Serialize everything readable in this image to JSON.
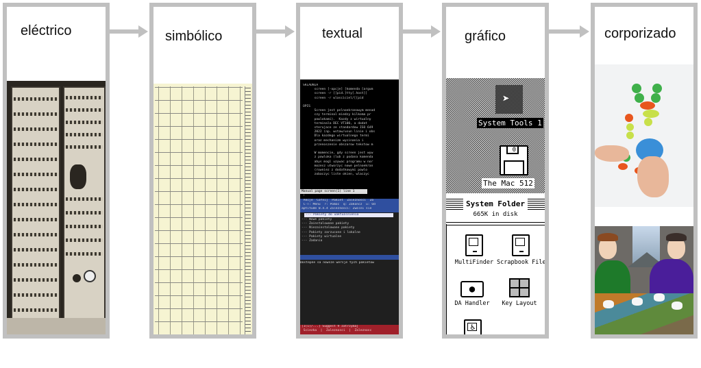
{
  "diagram": {
    "stages": [
      {
        "id": "electric",
        "title": "eléctrico",
        "image": "early electromechanical computer rack"
      },
      {
        "id": "symbolic",
        "title": "simbólico",
        "image": "punched symbolic code sheet"
      },
      {
        "id": "textual",
        "title": "textual",
        "image": "text-mode terminal screen"
      },
      {
        "id": "graphical",
        "title": "gráfico",
        "image": "classic Macintosh desktop"
      },
      {
        "id": "embodied",
        "title": "corporizado",
        "image": "tangible robot kit and virtual characters"
      }
    ],
    "connectors": [
      "arrow",
      "arrow",
      "arrow",
      "arrow"
    ],
    "colors": {
      "frame": "#c0c0c0",
      "arrow": "#c0c0c0",
      "background": "#ffffff",
      "text": "#111111"
    }
  },
  "terminal": {
    "lines": [
      "SKLADNIA",
      "      screen [-opcje] [komenda [argum",
      "      screen -r [[pid.]tty[.host]]",
      "      screen -r wlasciciel/[[pid",
      "",
      "OPIS",
      "      Screen jest pelnoekranowym menad",
      "      czy terminal miedzy kilkoma pr",
      "      powlokami).  Kazdy z wirtualny",
      "      terminala DEC VT100, a dodat",
      "      sterujace ze standardow ISO 649",
      "      2022 (np. wstaw/usun linie i obs",
      "      Dla kazdego wirtualnego termi",
      "      oraz mechanizm wycinania i",
      "      przenoszenie obszarow tekstow m",
      "",
      "      W momencie, gdy screen jest wyw",
      "      z powloka (lub z podana komenda",
      "      abys mogl uzywac programu w nor",
      "      mozesz utworzyc nowe pelnoekran",
      "      (rowniez z dodatkowymi powlo",
      "      zobaczyc liste okien, wlaczyc"
    ],
    "status_line": "Manual page screen(1) line 1",
    "prompt": ":",
    "menu_lines": [
      " Akcje  Cofnij  Pakiet  Zaleznosci  Zo",
      " C-T: Menu  ?: Pomoc  q: Zakoncz  u: Od",
      "aptitude 0.4.4 Zaleznosci: Zwolni sie"
    ],
    "selected_item": "--- Pakiety do uaktualnienia",
    "items": [
      "--- Nowe pakiety",
      "--- Zainstalowane pakiety",
      "--- Niezainstalowane pakiety",
      "--- Pakiety zarzucone i lokalne",
      "--- Pakiety wirtualne",
      "--- Zadania"
    ],
    "info_line": "Dostepne sa nowsze wersje tych pakietow",
    "footer_lines": [
      "[1(1)/...] Suggest 9 zatrzymaj",
      " Sciezka  |  Zaleznosci  |  Zaleznosc"
    ]
  },
  "mac": {
    "folder_icon_label": "System Tools 1",
    "disk_label": "The Mac 512",
    "disk_shutter": "0",
    "window_title": "System Folder",
    "window_info": "665K in disk",
    "icons": [
      {
        "label": "MultiFinder",
        "icon": "compact-mac-icon"
      },
      {
        "label": "Scrapbook FileC",
        "icon": "compact-mac-icon"
      },
      {
        "label": "DA Handler",
        "icon": "suitcase-icon",
        "glyph": ""
      },
      {
        "label": "Key Layout",
        "icon": "grid-icon"
      },
      {
        "label": "",
        "icon": "accessibility-icon",
        "glyph": "♿"
      }
    ]
  }
}
